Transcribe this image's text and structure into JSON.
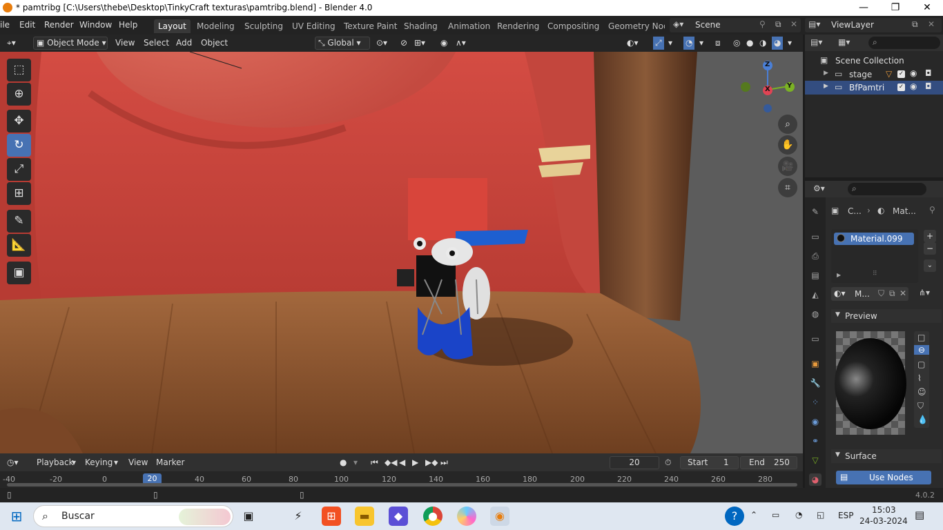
{
  "window": {
    "title": "* pamtribg [C:\\Users\\thebe\\Desktop\\TinkyCraft texturas\\pamtribg.blend] - Blender 4.0"
  },
  "menu": [
    "ile",
    "Edit",
    "Render",
    "Window",
    "Help"
  ],
  "workspaces": [
    "Layout",
    "Modeling",
    "Sculpting",
    "UV Editing",
    "Texture Paint",
    "Shading",
    "Animation",
    "Rendering",
    "Compositing",
    "Geometry Node"
  ],
  "scene": {
    "name": "Scene",
    "view_layer": "ViewLayer"
  },
  "viewport_header": {
    "mode": "Object Mode",
    "menus": [
      "View",
      "Select",
      "Add",
      "Object"
    ],
    "orientation": "Global"
  },
  "gizmo": {
    "z": "Z",
    "x": "X",
    "y": "Y"
  },
  "outliner": {
    "root": "Scene Collection",
    "items": [
      {
        "name": "stage"
      },
      {
        "name": "BfPamtri"
      }
    ]
  },
  "properties": {
    "breadcrumb_a": "C...",
    "breadcrumb_b": "Mat...",
    "material_slot": "Material.099",
    "material_name": "M...",
    "preview_label": "Preview",
    "surface_label": "Surface",
    "use_nodes_label": "Use Nodes"
  },
  "timeline": {
    "menus": [
      "Playback",
      "Keying",
      "View",
      "Marker"
    ],
    "current_frame": "20",
    "start_label": "Start",
    "start": "1",
    "end_label": "End",
    "end": "250",
    "ticks": [
      "-40",
      "-20",
      "0",
      "20",
      "40",
      "60",
      "80",
      "100",
      "120",
      "140",
      "160",
      "180",
      "200",
      "220",
      "240",
      "260",
      "280"
    ]
  },
  "status": {
    "version": "4.0.2"
  },
  "taskbar": {
    "search_placeholder": "Buscar",
    "language": "ESP",
    "time": "15:03",
    "date": "24-03-2024"
  },
  "colors": {
    "accent": "#4772b3",
    "curtain": "#c9483f",
    "floor": "#8a5530"
  }
}
